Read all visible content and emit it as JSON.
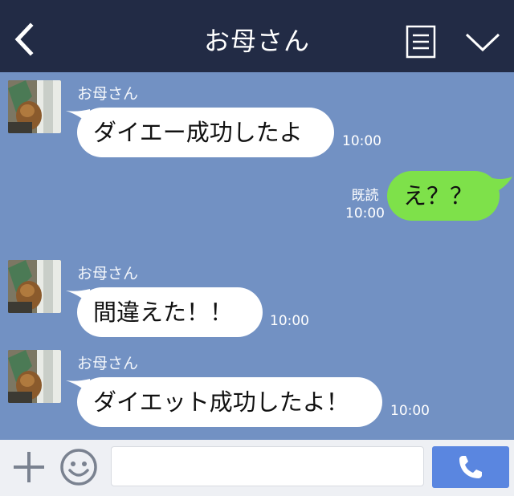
{
  "header": {
    "title": "お母さん"
  },
  "messages": [
    {
      "sender": "お母さん",
      "text": "ダイエー成功したよ",
      "time": "10:00"
    },
    {
      "read_label": "既読",
      "time": "10:00",
      "text": "え？？"
    },
    {
      "sender": "お母さん",
      "text": "間違えた！！",
      "time": "10:00"
    },
    {
      "sender": "お母さん",
      "text": "ダイエット成功したよ！",
      "time": "10:00"
    }
  ],
  "colors": {
    "header_bg": "#222b45",
    "chat_bg": "#7291c3",
    "incoming_bubble": "#ffffff",
    "outgoing_bubble": "#7ee14a",
    "send_button": "#5a86e0"
  },
  "icons": [
    "back-icon",
    "menu-icon",
    "chevron-down-icon",
    "plus-icon",
    "smile-icon",
    "phone-icon"
  ]
}
